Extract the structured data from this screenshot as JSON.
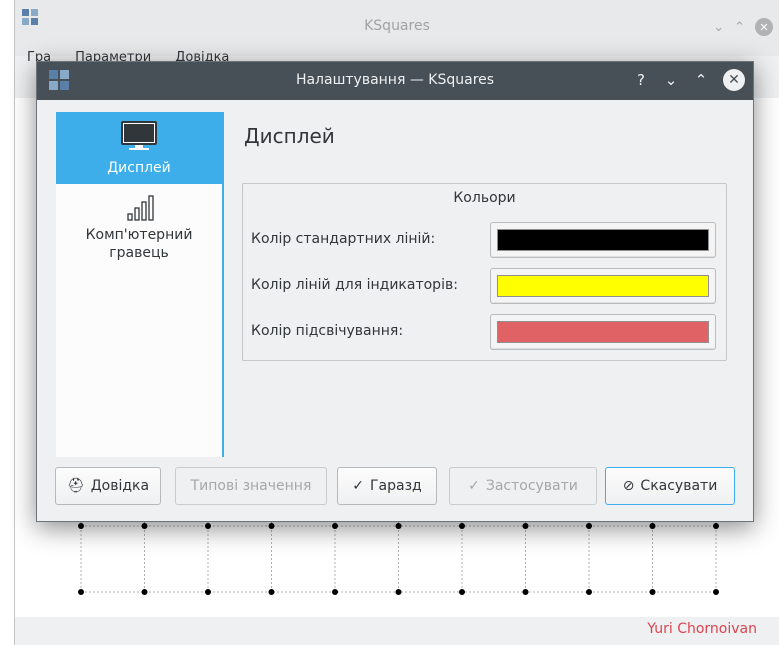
{
  "main_window": {
    "title": "KSquares",
    "menu": [
      "Гра",
      "Параметри",
      "Довідка"
    ],
    "status_user": "Yuri Chornoivan"
  },
  "dialog": {
    "title": "Налаштування — KSquares",
    "help_glyph": "?",
    "minimize_glyph": "⌄",
    "maximize_glyph": "⌃",
    "close_glyph": "✕",
    "sidebar": [
      {
        "label": "Дисплей",
        "icon": "monitor-icon",
        "selected": true
      },
      {
        "label": "Комп'ютерний гравець",
        "icon": "signal-bars-icon",
        "selected": false
      }
    ],
    "page_title": "Дисплей",
    "group": {
      "title": "Кольори",
      "rows": [
        {
          "label": "Колір стандартних ліній:",
          "color": "#000000"
        },
        {
          "label": "Колір ліній для індикаторів:",
          "color": "#ffff00"
        },
        {
          "label": "Колір підсвічування:",
          "color": "#e06264"
        }
      ]
    },
    "buttons": {
      "help": {
        "label": "Довідка",
        "icon": "lifebuoy-icon"
      },
      "defaults": {
        "label": "Типові значення"
      },
      "ok": {
        "label": "Гаразд",
        "icon": "checkmark-icon"
      },
      "apply": {
        "label": "Застосувати",
        "icon": "checkmark-icon"
      },
      "cancel": {
        "label": "Скасувати",
        "icon": "cancel-circle-icon"
      }
    }
  },
  "colors": {
    "accent": "#3daee9",
    "titlebar": "#475057",
    "window_bg": "#eff0f1"
  }
}
